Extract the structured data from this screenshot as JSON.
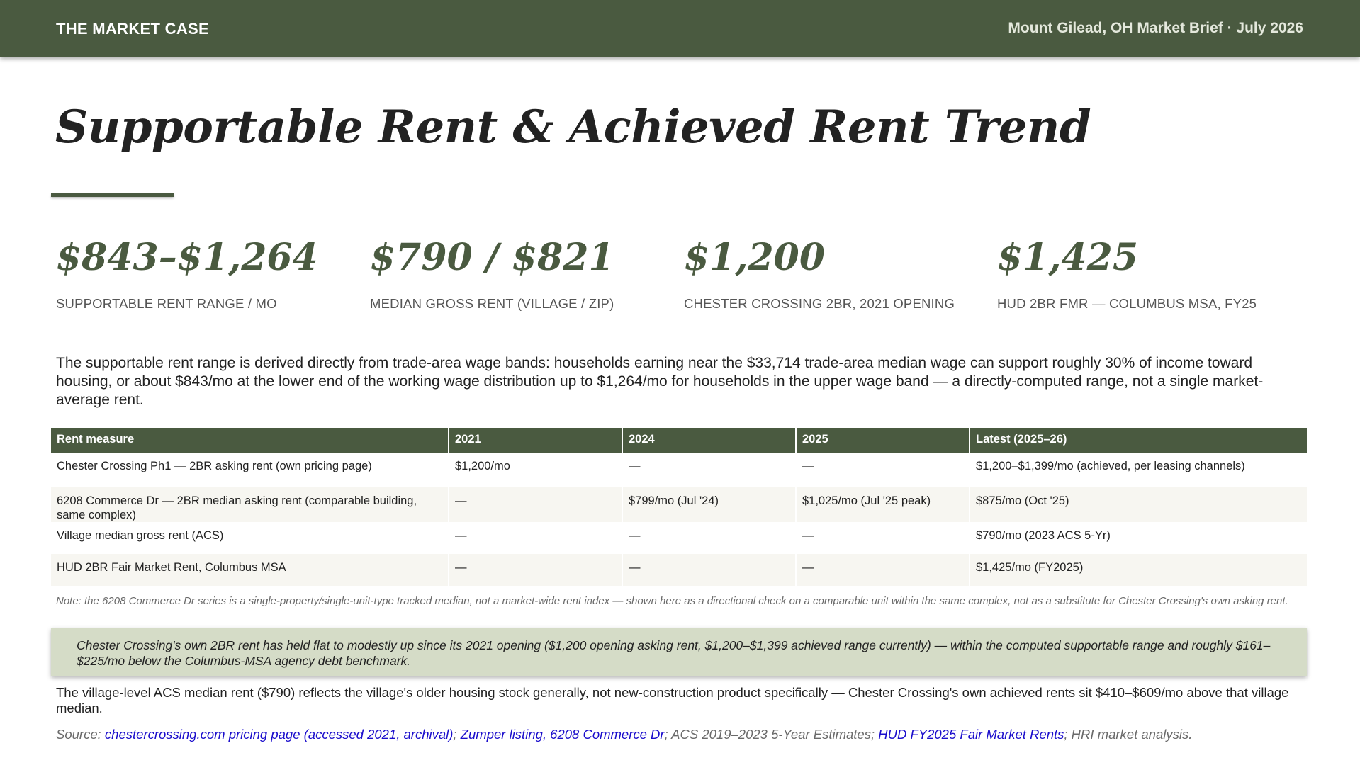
{
  "header": {
    "brand": "THE MARKET CASE",
    "brief": "Mount Gilead, OH Market Brief · July 2026"
  },
  "title": "Supportable Rent & Achieved Rent Trend",
  "stats": [
    {
      "value": "$843–$1,264",
      "label": "SUPPORTABLE RENT RANGE / MO"
    },
    {
      "value": "$790 / $821",
      "label": "MEDIAN GROSS RENT (VILLAGE / ZIP)"
    },
    {
      "value": "$1,200",
      "label": "CHESTER CROSSING 2BR, 2021 OPENING"
    },
    {
      "value": "$1,425",
      "label": "HUD 2BR FMR — COLUMBUS MSA, FY25"
    }
  ],
  "intro": "The supportable rent range is derived directly from trade-area wage bands: households earning near the $33,714 trade-area median wage can support roughly 30% of income toward housing, or about $843/mo at the lower end of the working wage distribution up to $1,264/mo for households in the upper wage band — a directly-computed range, not a single market-average rent.",
  "table": {
    "headers": [
      "Rent measure",
      "2021",
      "2024",
      "2025",
      "Latest (2025–26)"
    ],
    "rows": [
      [
        "Chester Crossing Ph1 — 2BR asking rent (own pricing page)",
        "$1,200/mo",
        "—",
        "—",
        "$1,200–$1,399/mo (achieved, per leasing channels)"
      ],
      [
        "6208 Commerce Dr — 2BR median asking rent (comparable building, same complex)",
        "—",
        "$799/mo (Jul '24)",
        "$1,025/mo (Jul '25 peak)",
        "$875/mo (Oct '25)"
      ],
      [
        "Village median gross rent (ACS)",
        "—",
        "—",
        "—",
        "$790/mo (2023 ACS 5-Yr)"
      ],
      [
        "HUD 2BR Fair Market Rent, Columbus MSA",
        "—",
        "—",
        "—",
        "$1,425/mo (FY2025)"
      ]
    ]
  },
  "note": "Note: the 6208 Commerce Dr series is a single-property/single-unit-type tracked median, not a market-wide rent index — shown here as a directional check on a comparable unit within the same complex, not as a substitute for Chester Crossing's own asking rent.",
  "callout": "Chester Crossing's own 2BR rent has held flat to modestly up since its 2021 opening ($1,200 opening asking rent, $1,200–$1,399 achieved range currently) — within the computed supportable range and roughly $161–$225/mo below the Columbus-MSA agency debt benchmark.",
  "closing": "The village-level ACS median rent ($790) reflects the village's older housing stock generally, not new-construction product specifically — Chester Crossing's own achieved rents sit $410–$609/mo above that village median.",
  "source": {
    "prefix": "Source: ",
    "link1": "chestercrossing.com pricing page (accessed 2021, archival)",
    "sep1": "; ",
    "link2": "Zumper listing, 6208 Commerce Dr",
    "mid": "; ACS 2019–2023 5-Year Estimates; ",
    "link3": "HUD FY2025 Fair Market Rents",
    "suffix": "; HRI market analysis."
  },
  "colors": {
    "accent": "#4a5a40",
    "callout_bg": "#d5dcc7",
    "link": "#1a0dcc"
  }
}
